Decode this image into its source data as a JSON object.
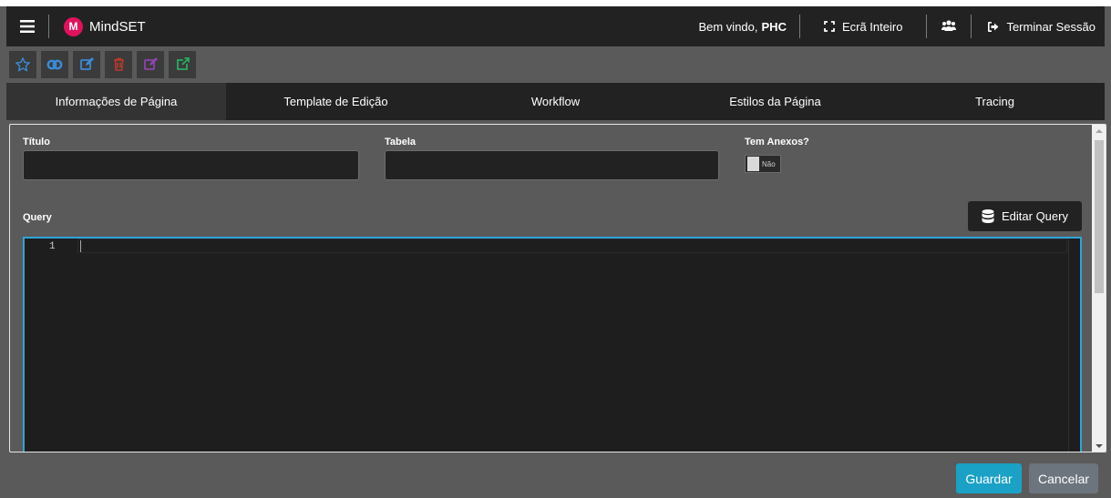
{
  "app": {
    "name": "MindSET",
    "logo_letter": "M",
    "brand_color": "#e0125d"
  },
  "navbar": {
    "welcome_prefix": "Bem vindo,",
    "user": "PHC",
    "fullscreen_label": "Ecrã Inteiro",
    "logout_label": "Terminar Sessão"
  },
  "toolbar": {
    "buttons": [
      {
        "icon": "star-icon",
        "color": "#3b8bd6"
      },
      {
        "icon": "link-icon",
        "color": "#3b8bd6"
      },
      {
        "icon": "edit-icon",
        "color": "#3b8bd6"
      },
      {
        "icon": "trash-icon",
        "color": "#c0392b"
      },
      {
        "icon": "external-edit-icon",
        "color": "#8e44ad"
      },
      {
        "icon": "external-link-icon",
        "color": "#27ae60"
      }
    ]
  },
  "tabs": [
    {
      "label": "Informações de Página",
      "active": true
    },
    {
      "label": "Template de Edição",
      "active": false
    },
    {
      "label": "Workflow",
      "active": false
    },
    {
      "label": "Estilos da Página",
      "active": false
    },
    {
      "label": "Tracing",
      "active": false
    }
  ],
  "form": {
    "titulo_label": "Título",
    "titulo_value": "",
    "tabela_label": "Tabela",
    "tabela_value": "",
    "anexos_label": "Tem Anexos?",
    "anexos_toggle_text": "Não",
    "query_label": "Query",
    "edit_query_label": "Editar Query"
  },
  "editor": {
    "line_number": "1",
    "border_color": "#2fa4d8"
  },
  "footer": {
    "save_label": "Guardar",
    "cancel_label": "Cancelar",
    "save_color": "#1ba1c5",
    "cancel_color": "#6c757d"
  }
}
